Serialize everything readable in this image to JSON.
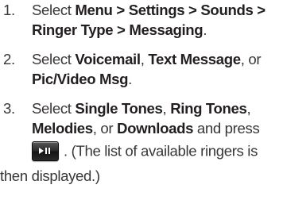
{
  "steps": [
    {
      "number": "1.",
      "parts": [
        "Select ",
        "Menu > Settings > Sounds > Ringer Type > Messaging",
        "."
      ]
    },
    {
      "number": "2.",
      "parts": [
        "Select ",
        "Voicemail",
        ", ",
        "Text Message",
        ", or ",
        "Pic/Video Msg",
        "."
      ]
    },
    {
      "number": "3.",
      "parts": [
        "Select ",
        "Single Tones",
        ", ",
        "Ring Tones",
        ", ",
        "Melodies",
        ", or ",
        "Downloads",
        " and press",
        ". (The list of available ringers is",
        "then displayed.)"
      ],
      "key_icon": "play-pause-key-icon"
    }
  ]
}
